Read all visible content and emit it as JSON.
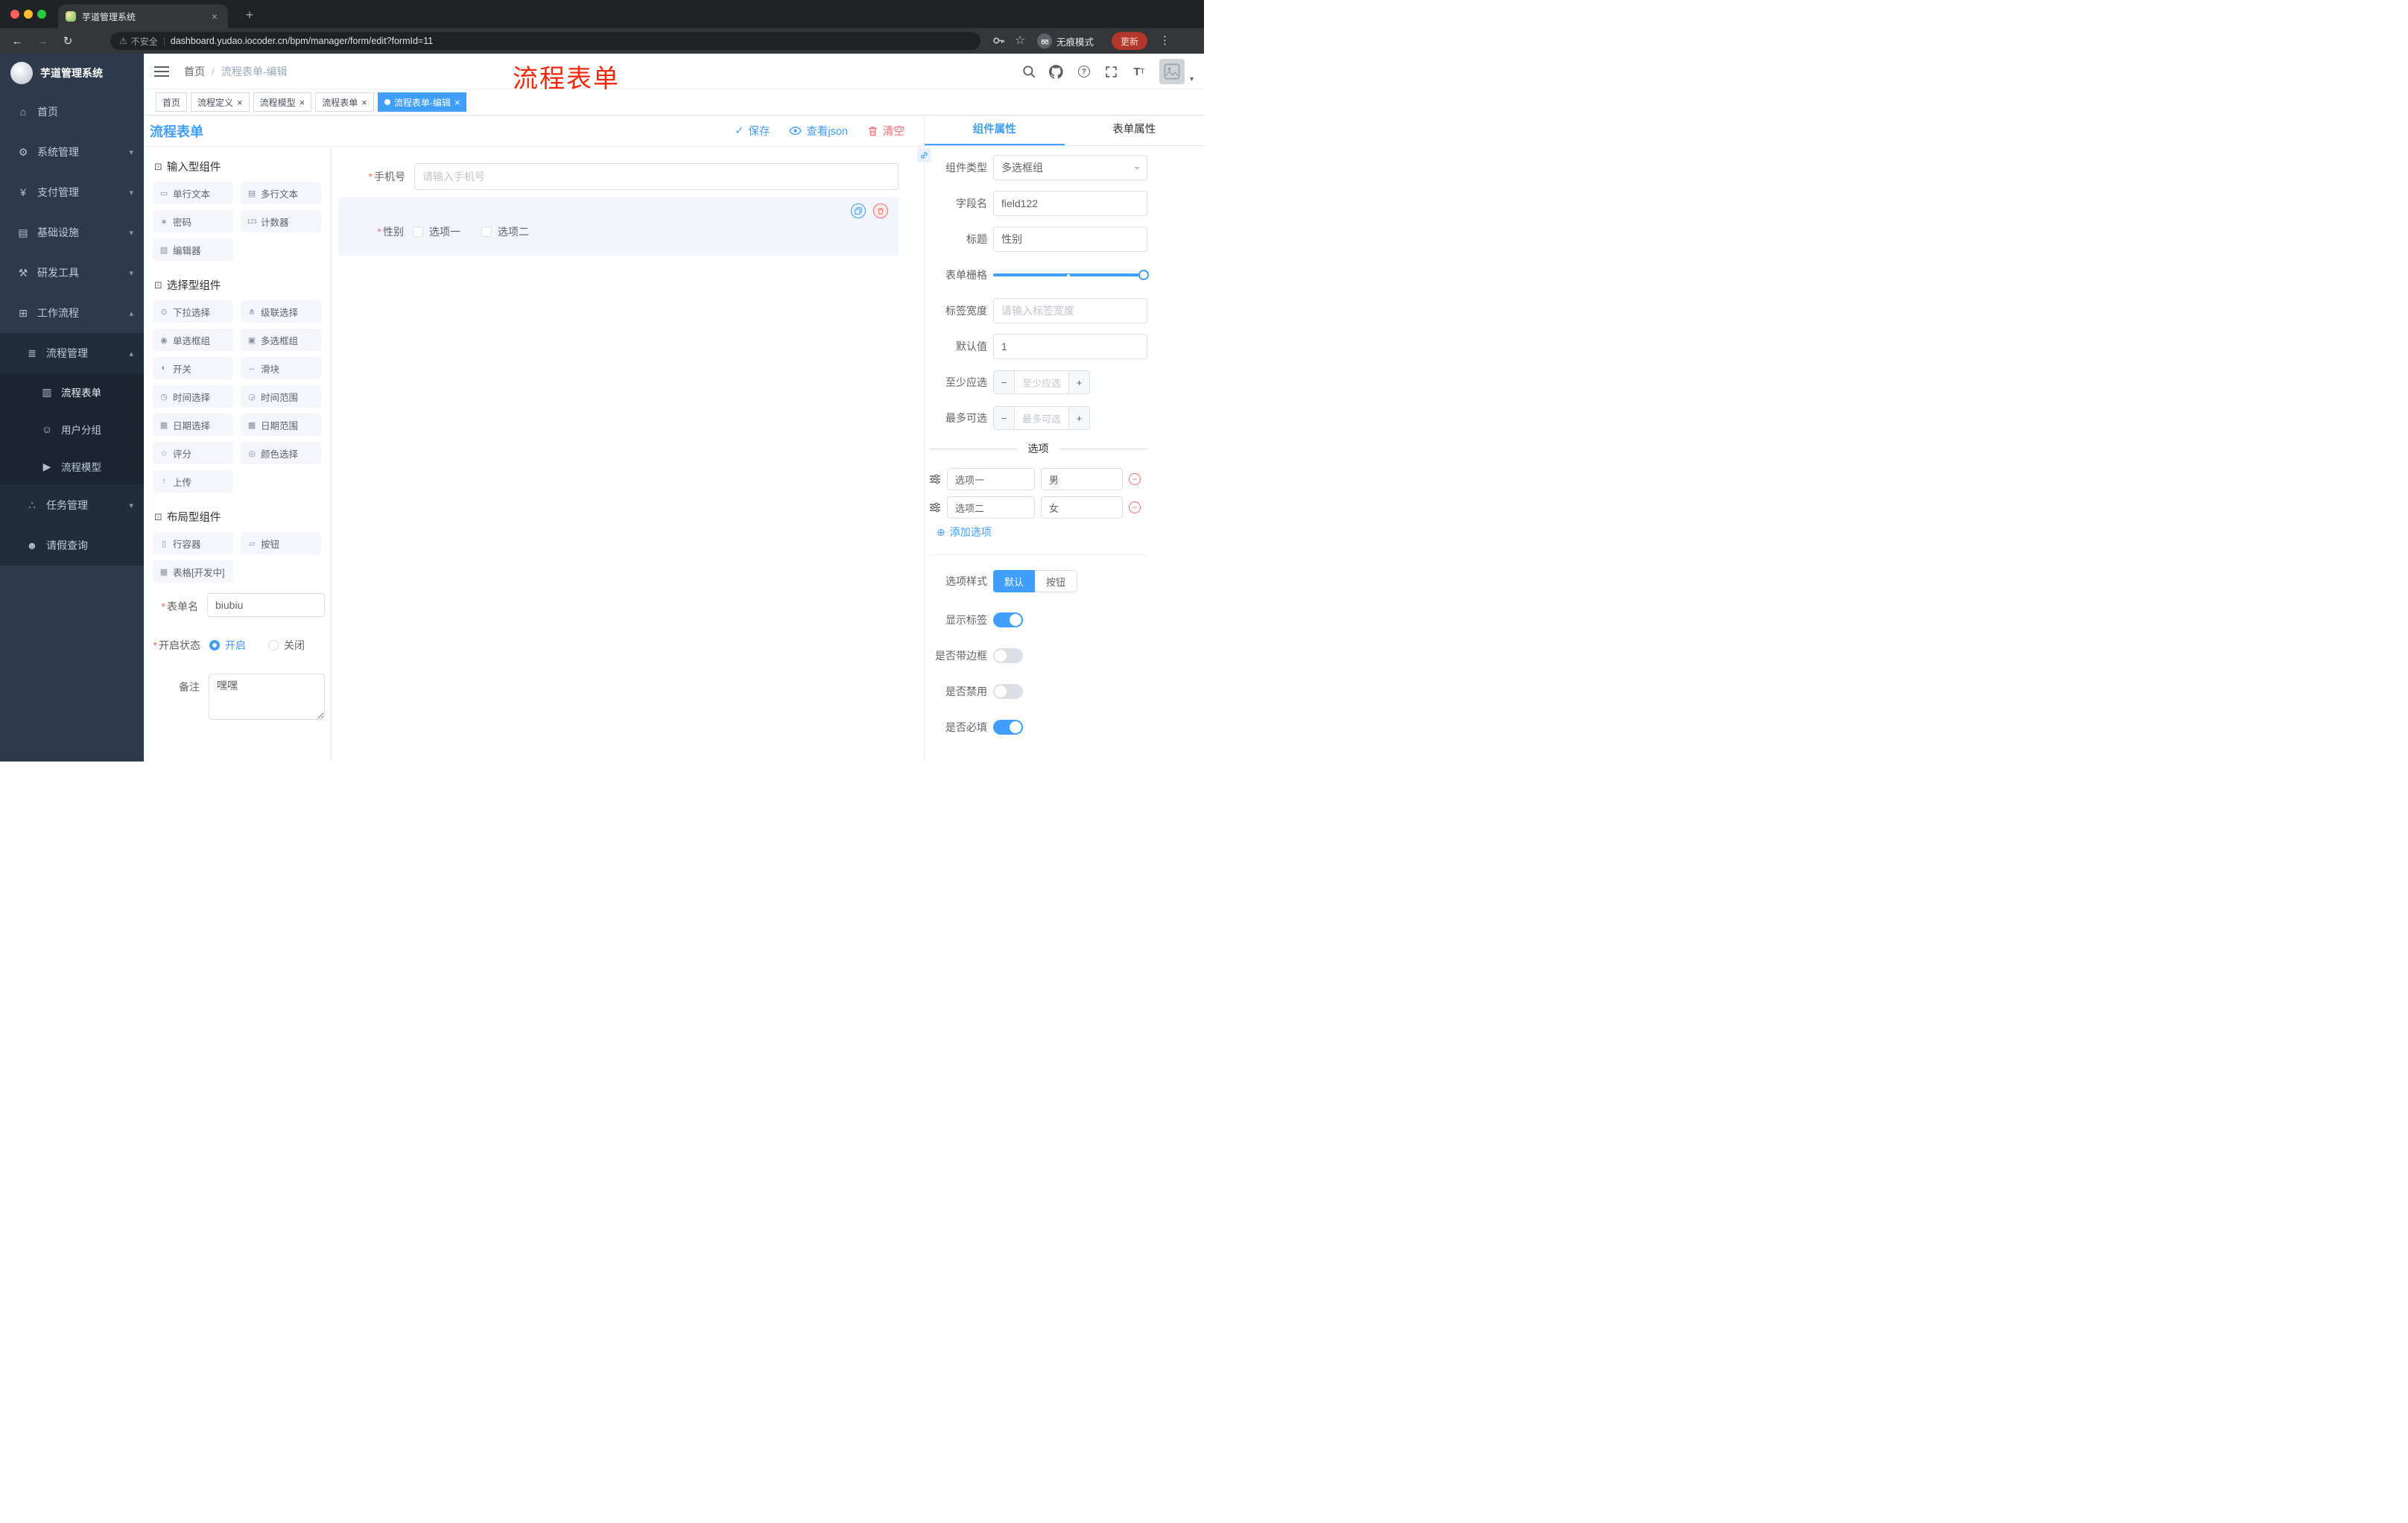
{
  "browser": {
    "tab_title": "芋道管理系统",
    "security": "不安全",
    "url": "dashboard.yudao.iocoder.cn/bpm/manager/form/edit?formId=11",
    "incognito": "无痕模式",
    "update": "更新"
  },
  "icons": {
    "back": "←",
    "forward": "→",
    "reload": "↻",
    "close": "×",
    "new_tab": "+",
    "more": "⋮",
    "star": "☆",
    "warning": "⚠",
    "question": "?",
    "text_size": "T",
    "home": "⌂",
    "gear": "⚙",
    "yen": "¥",
    "infra": "▤",
    "tools": "⚒",
    "workflow": "⊞",
    "list": "≣",
    "doc": "▥",
    "users": "☺",
    "send": "▶",
    "tasks": "∴",
    "person": "☻",
    "caret_down": "▾",
    "caret_up": "▴",
    "check": "✓",
    "cube": "⊡",
    "minus": "−",
    "plus": "+",
    "add_circle": "⊕",
    "required": "*",
    "input": "▭",
    "textarea_i": "▤",
    "password": "∗",
    "counter": "123",
    "editor": "▧",
    "select": "⊙",
    "cascade": "⋔",
    "radio": "◉",
    "checkbox": "▣",
    "switch": "◐",
    "slider": "↔",
    "time": "◷",
    "timerange": "◶",
    "date": "▦",
    "daterange": "▩",
    "rate": "☆",
    "color": "◎",
    "upload": "↑",
    "row": "▯",
    "button": "▱",
    "table": "▦"
  },
  "sidebar": {
    "title": "芋道管理系统",
    "items": [
      {
        "label": "首页"
      },
      {
        "label": "系统管理"
      },
      {
        "label": "支付管理"
      },
      {
        "label": "基础设施"
      },
      {
        "label": "研发工具"
      },
      {
        "label": "工作流程"
      }
    ],
    "sub": [
      {
        "label": "流程管理"
      },
      {
        "label": "流程表单"
      },
      {
        "label": "用户分组"
      },
      {
        "label": "流程模型"
      },
      {
        "label": "任务管理"
      },
      {
        "label": "请假查询"
      }
    ]
  },
  "header": {
    "breadcrumb_home": "首页",
    "breadcrumb_sep": "/",
    "breadcrumb_current": "流程表单-编辑",
    "annotation": "流程表单"
  },
  "tags": [
    {
      "label": "首页"
    },
    {
      "label": "流程定义"
    },
    {
      "label": "流程模型"
    },
    {
      "label": "流程表单"
    },
    {
      "label": "流程表单-编辑"
    }
  ],
  "page": {
    "title": "流程表单",
    "save": "保存",
    "view_json": "查看json",
    "clear": "清空"
  },
  "palette": {
    "groups": [
      {
        "title": "输入型组件",
        "items": [
          "单行文本",
          "多行文本",
          "密码",
          "计数器",
          "编辑器"
        ]
      },
      {
        "title": "选择型组件",
        "items": [
          "下拉选择",
          "级联选择",
          "单选框组",
          "多选框组",
          "开关",
          "滑块",
          "时间选择",
          "时间范围",
          "日期选择",
          "日期范围",
          "评分",
          "颜色选择",
          "上传"
        ]
      },
      {
        "title": "布局型组件",
        "items": [
          "行容器",
          "按钮",
          "表格[开发中]"
        ]
      }
    ],
    "form": {
      "name_label": "表单名",
      "name_value": "biubiu",
      "status_label": "开启状态",
      "status_on": "开启",
      "status_off": "关闭",
      "remark_label": "备注",
      "remark_value": "嘿嘿"
    }
  },
  "canvas": {
    "phone_label": "手机号",
    "phone_placeholder": "请输入手机号",
    "gender_label": "性别",
    "gender_opt1": "选项一",
    "gender_opt2": "选项二"
  },
  "props": {
    "tab_component": "组件属性",
    "tab_form": "表单属性",
    "type_label": "组件类型",
    "type_value": "多选框组",
    "field_label": "字段名",
    "field_value": "field122",
    "title_label": "标题",
    "title_value": "性别",
    "grid_label": "表单栅格",
    "width_label": "标签宽度",
    "width_placeholder": "请输入标签宽度",
    "default_label": "默认值",
    "default_value": "1",
    "min_label": "至少应选",
    "min_placeholder": "至少应选",
    "max_label": "最多可选",
    "max_placeholder": "最多可选",
    "options_divider": "选项",
    "options": [
      {
        "name": "选项一",
        "value": "男"
      },
      {
        "name": "选项二",
        "value": "女"
      }
    ],
    "add_option": "添加选项",
    "style_label": "选项样式",
    "style_default": "默认",
    "style_button": "按钮",
    "show_label": "显示标签",
    "border_label": "是否带边框",
    "disabled_label": "是否禁用",
    "required_label": "是否必填"
  },
  "colors": {
    "primary": "#409EFF",
    "danger": "#F56C6C"
  }
}
